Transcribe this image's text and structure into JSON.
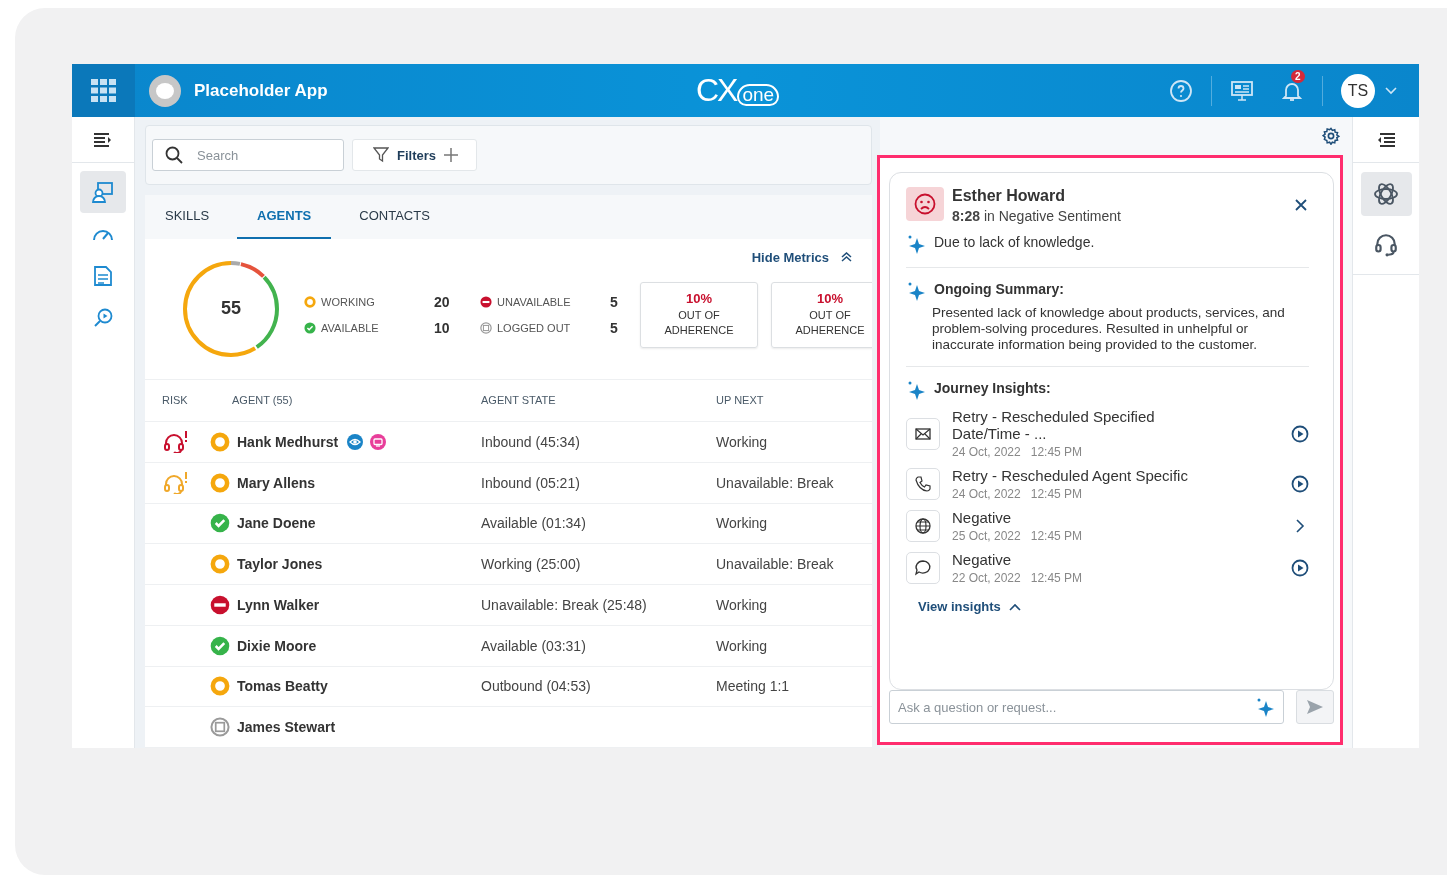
{
  "header": {
    "app_name": "Placeholder App",
    "logo_main": "CX",
    "logo_sub": "one",
    "notification_count": "2",
    "user_initials": "TS"
  },
  "toolbar": {
    "search_placeholder": "Search",
    "filters_label": "Filters"
  },
  "tabs": [
    {
      "label": "SKILLS",
      "selected": false
    },
    {
      "label": "AGENTS",
      "selected": true
    },
    {
      "label": "CONTACTS",
      "selected": false
    }
  ],
  "metrics": {
    "hide_label": "Hide Metrics",
    "total": "55",
    "stats": [
      {
        "kind": "working",
        "label": "WORKING",
        "value": "20"
      },
      {
        "kind": "available",
        "label": "AVAILABLE",
        "value": "10"
      },
      {
        "kind": "unavailable",
        "label": "UNAVAILABLE",
        "value": "5"
      },
      {
        "kind": "logged_out",
        "label": "LOGGED OUT",
        "value": "5"
      }
    ],
    "adherence": [
      {
        "percent": "10%",
        "label": "OUT OF ADHERENCE"
      },
      {
        "percent": "10%",
        "label": "OUT OF ADHERENCE"
      }
    ]
  },
  "table": {
    "columns": [
      "RISK",
      "AGENT (55)",
      "AGENT STATE",
      "UP NEXT"
    ],
    "rows": [
      {
        "risk": {
          "kind": "high"
        },
        "status": {
          "kind": "working"
        },
        "name": "Hank Medhurst",
        "indicators": [
          {
            "kind": "monitor"
          },
          {
            "kind": "screen"
          }
        ],
        "state": "Inbound (45:34)",
        "up_next": "Working"
      },
      {
        "risk": {
          "kind": "medium"
        },
        "status": {
          "kind": "working"
        },
        "name": "Mary Allens",
        "state": "Inbound (05:21)",
        "up_next": "Unavailable: Break"
      },
      {
        "status": {
          "kind": "available"
        },
        "name": "Jane Doene",
        "state": "Available (01:34)",
        "up_next": "Working"
      },
      {
        "status": {
          "kind": "working"
        },
        "name": "Taylor Jones",
        "state": "Working (25:00)",
        "up_next": "Unavailable: Break"
      },
      {
        "status": {
          "kind": "unavailable"
        },
        "name": "Lynn Walker",
        "state": "Unavailable: Break (25:48)",
        "up_next": "Working"
      },
      {
        "status": {
          "kind": "available"
        },
        "name": "Dixie Moore",
        "state": "Available (03:31)",
        "up_next": "Working"
      },
      {
        "status": {
          "kind": "working"
        },
        "name": "Tomas Beatty",
        "state": "Outbound (04:53)",
        "up_next": "Meeting 1:1"
      },
      {
        "status": {
          "kind": "logged_out"
        },
        "name": "James Stewart"
      }
    ]
  },
  "insight": {
    "customer": "Esther Howard",
    "sentiment": "**8:28** in Negative Sentiment",
    "reason": "Due to lack of knowledge.",
    "summary_title": "Ongoing Summary:",
    "summary": "Presented lack of knowledge about products, services, and problem-solving procedures. Resulted in unhelpful or inaccurate information being provided to the customer.",
    "journey_title": "Journey Insights:",
    "journey": [
      {
        "kind": "email",
        "title": "Retry - Rescheduled Specified Date/Time - ...",
        "date": "24 Oct, 2022",
        "time": "12:45 PM",
        "action": {
          "kind": "play"
        }
      },
      {
        "kind": "phone",
        "title": "Retry - Rescheduled Agent Specific",
        "date": "24 Oct, 2022",
        "time": "12:45 PM",
        "action": {
          "kind": "play"
        }
      },
      {
        "kind": "web",
        "title": "Negative",
        "date": "25 Oct, 2022",
        "time": "12:45 PM",
        "action": {
          "kind": "open"
        }
      },
      {
        "kind": "chat",
        "title": "Negative",
        "date": "22 Oct, 2022",
        "time": "12:45 PM",
        "action": {
          "kind": "play"
        }
      }
    ],
    "view_label": "View insights",
    "ask_placeholder": "Ask a question or request..."
  }
}
